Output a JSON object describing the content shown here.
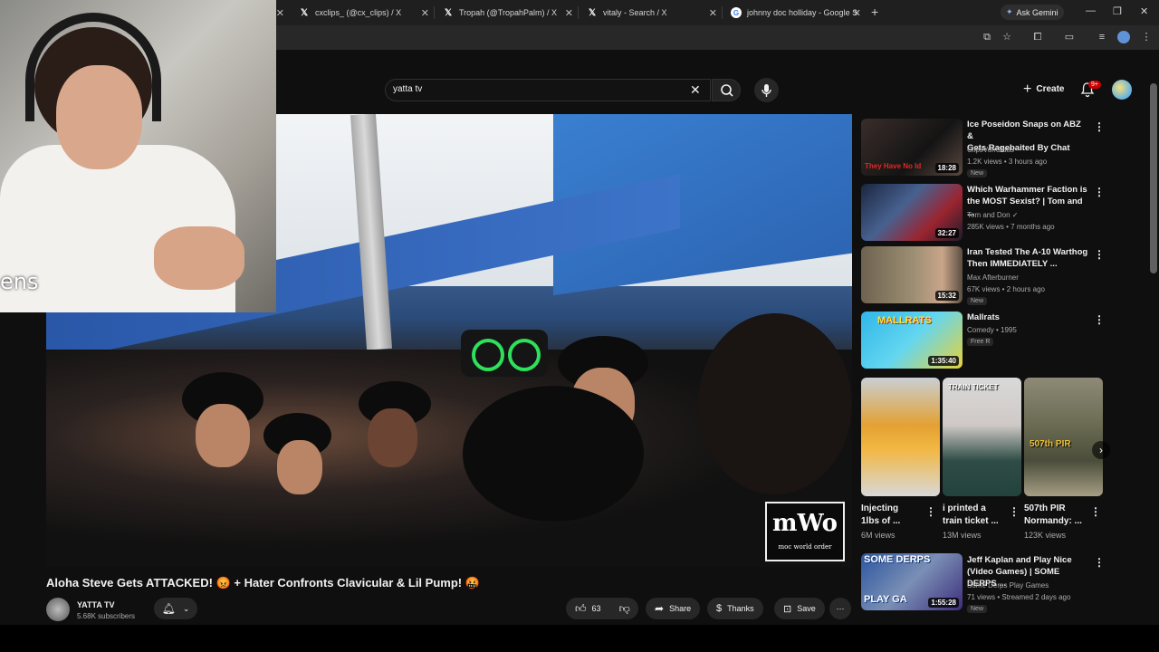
{
  "browser": {
    "tabs": [
      {
        "title": "cxclips_ (@cx_clips) / X",
        "icon": "x-logo"
      },
      {
        "title": "Tropah (@TropahPalm) / X",
        "icon": "x-logo"
      },
      {
        "title": "vitaly - Search / X",
        "icon": "x-logo"
      },
      {
        "title": "johnny doc holliday - Google S",
        "icon": "google-logo"
      }
    ],
    "gemini_label": "Ask Gemini"
  },
  "youtube": {
    "search_value": "yatta tv",
    "create_label": "Create",
    "notification_badge": "9+"
  },
  "overlay": {
    "cam_text": "ens",
    "watermark_big": "mWo",
    "watermark_small": "moc world order"
  },
  "video": {
    "title": "Aloha Steve Gets ATTACKED! 😡 + Hater Confronts Clavicular & Lil Pump! 🤬",
    "channel_name": "YATTA TV",
    "subscribers": "5.68K subscribers",
    "likes": "63",
    "share_label": "Share",
    "thanks_label": "Thanks",
    "save_label": "Save"
  },
  "sidebar": {
    "videos": [
      {
        "title1": "Ice Poseidon Snaps on ABZ &",
        "title2": "Gets Ragebaited By Chat",
        "channel": "ClipsVonClaus",
        "meta": "1.2K views • 3 hours ago",
        "badge": "New",
        "duration": "18:28",
        "thumb_text": "They Have No Id"
      },
      {
        "title1": "Which Warhammer Faction is",
        "title2": "the MOST Sexist? | Tom and ...",
        "channel": "Tom and Don ✓",
        "meta": "285K views • 7 months ago",
        "badge": "",
        "duration": "32:27",
        "thumb_text": ""
      },
      {
        "title1": "Iran Tested The A-10 Warthog",
        "title2": "Then IMMEDIATELY ...",
        "channel": "Max Afterburner",
        "meta": "67K views • 2 hours ago",
        "badge": "New",
        "duration": "15:32",
        "thumb_text": ""
      },
      {
        "title1": "Mallrats",
        "title2": "",
        "channel": "Comedy • 1995",
        "meta": "",
        "badge": "Free  R",
        "duration": "1:35:40",
        "thumb_text": "MALLRATS"
      }
    ],
    "shorts": [
      {
        "title1": "Injecting",
        "title2": "1lbs of ...",
        "views": "6M views",
        "thumb_text": ""
      },
      {
        "title1": "i printed a",
        "title2": "train ticket ...",
        "views": "13M views",
        "thumb_text": "TRAIN TICKET"
      },
      {
        "title1": "507th PIR",
        "title2": "Normandy: ...",
        "views": "123K views",
        "thumb_text": "507th PIR"
      }
    ],
    "bottom_video": {
      "title1": "Jeff Kaplan and Play Nice",
      "title2": "(Video Games) | SOME DERPS ...",
      "channel": "Some Derps Play Games",
      "meta": "71 views • Streamed 2 days ago",
      "badge": "New",
      "duration": "1:55:28",
      "thumb_text1": "SOME DERPS",
      "thumb_text2": "PLAY GA"
    }
  },
  "colors": {
    "background": "#0f0f0f",
    "accent_red": "#cc0000",
    "pill": "#272727",
    "meta_text": "#aaaaaa"
  }
}
